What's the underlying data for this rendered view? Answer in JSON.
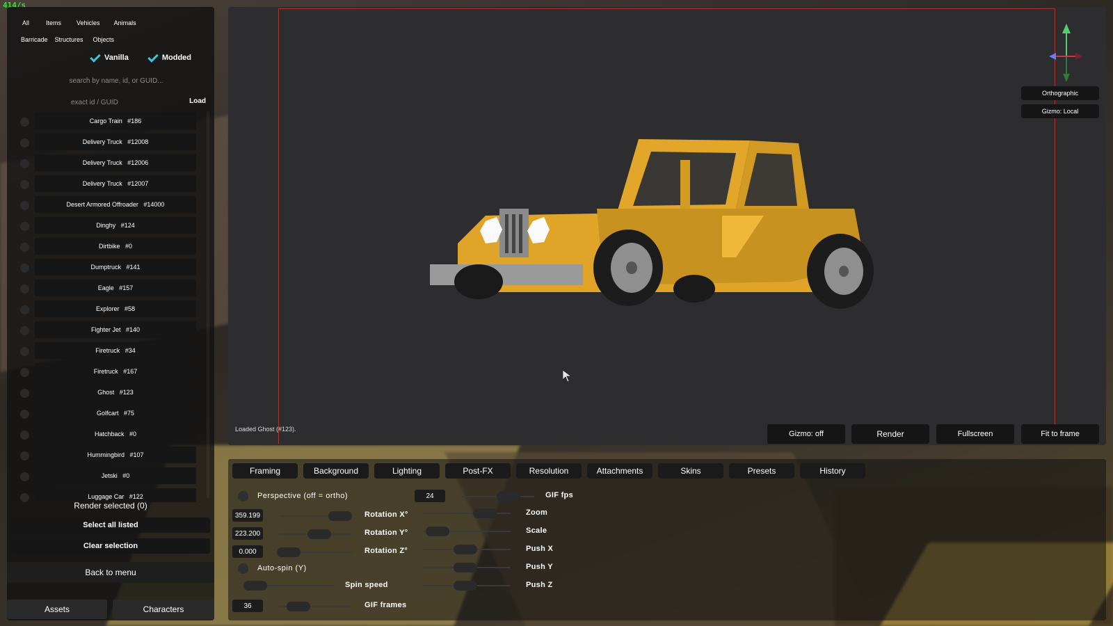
{
  "fps_counter": "414/s",
  "categories_row1": [
    "All",
    "Items",
    "Vehicles",
    "Animals"
  ],
  "categories_row2": [
    "Barricade",
    "Structures",
    "Objects"
  ],
  "filters": {
    "vanilla": "Vanilla",
    "modded": "Modded"
  },
  "search": {
    "placeholder": "search by name, id, or GUID..."
  },
  "exact": {
    "placeholder": "exact id / GUID",
    "load_label": "Load"
  },
  "assets": [
    "Cargo Train   #186",
    "Delivery Truck   #12008",
    "Delivery Truck   #12006",
    "Delivery Truck   #12007",
    "Desert Armored Offroader   #14000",
    "Dinghy   #124",
    "Dirtbike   #0",
    "Dumptruck   #141",
    "Eagle   #157",
    "Explorer   #58",
    "Fighter Jet   #140",
    "Firetruck   #34",
    "Firetruck   #167",
    "Ghost   #123",
    "Golfcart   #75",
    "Hatchback   #0",
    "Hummingbird   #107",
    "Jetski   #0",
    "Luggage Car   #122"
  ],
  "left_actions": {
    "render_selected": "Render selected (0)",
    "select_all": "Select all listed",
    "clear_selection": "Clear selection",
    "back_to_menu": "Back to menu",
    "assets": "Assets",
    "characters": "Characters"
  },
  "viewport": {
    "loaded_message": "Loaded Ghost (#123).",
    "orthographic": "Orthographic",
    "gizmo_local": "Gizmo: Local",
    "gizmo_off": "Gizmo: off",
    "render": "Render",
    "fullscreen": "Fullscreen",
    "fit_to_frame": "Fit to frame"
  },
  "tabs": [
    "Framing",
    "Background",
    "Lighting",
    "Post-FX",
    "Resolution",
    "Attachments",
    "Skins",
    "Presets",
    "History"
  ],
  "framing": {
    "perspective_label": "Perspective (off = ortho)",
    "gif_fps_value": "24",
    "gif_fps_label": "GIF fps",
    "rotation_x_value": "359.199",
    "rotation_x_label": "Rotation X°",
    "rotation_y_value": "223.200",
    "rotation_y_label": "Rotation Y°",
    "rotation_z_value": "0.000",
    "rotation_z_label": "Rotation Z°",
    "zoom_label": "Zoom",
    "scale_label": "Scale",
    "push_x_label": "Push X",
    "push_y_label": "Push Y",
    "push_z_label": "Push Z",
    "autospin_label": "Auto-spin (Y)",
    "spin_speed_label": "Spin speed",
    "gif_frames_value": "36",
    "gif_frames_label": "GIF frames"
  },
  "colors": {
    "accent_check": "#37c8d8",
    "fps_green": "#39e639",
    "frame_red": "#aa3333",
    "car_yellow": "#e8a825"
  }
}
